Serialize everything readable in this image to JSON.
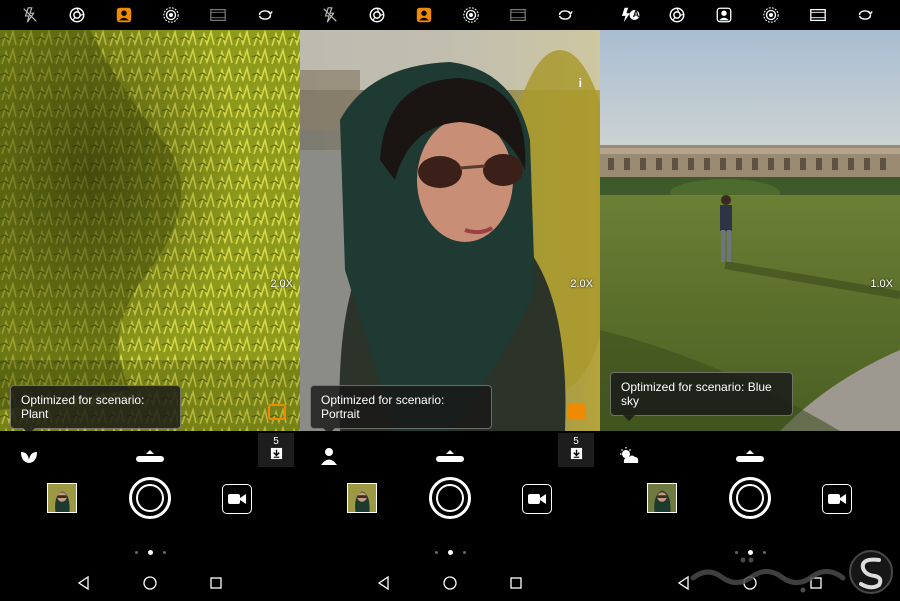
{
  "colors": {
    "accent": "#f08a00",
    "background": "#000000",
    "toast_bg": "#191919",
    "text": "#ffffff"
  },
  "top_icons": [
    "flash-icon",
    "aperture-icon",
    "portrait-mode-icon",
    "moving-picture-icon",
    "film-filter-icon",
    "switch-camera-icon"
  ],
  "panels": [
    {
      "zoom": "2.0X",
      "toast": "Optimized for scenario: Plant",
      "scene_icon": "plant-leaf-icon",
      "timer_count": "5",
      "flash_mode": "off"
    },
    {
      "zoom": "2.0X",
      "toast": "Optimized for scenario: Portrait",
      "scene_icon": "portrait-person-icon",
      "timer_count": "5",
      "info": "i",
      "flash_mode": "off"
    },
    {
      "zoom": "1.0X",
      "toast": "Optimized for scenario: Blue sky",
      "scene_icon": "blue-sky-cloud-icon",
      "flash_mode": "auto",
      "flash_label": "A"
    }
  ],
  "watermark": {
    "text": "سرزمین اپلیکیشن",
    "initial": "S"
  }
}
